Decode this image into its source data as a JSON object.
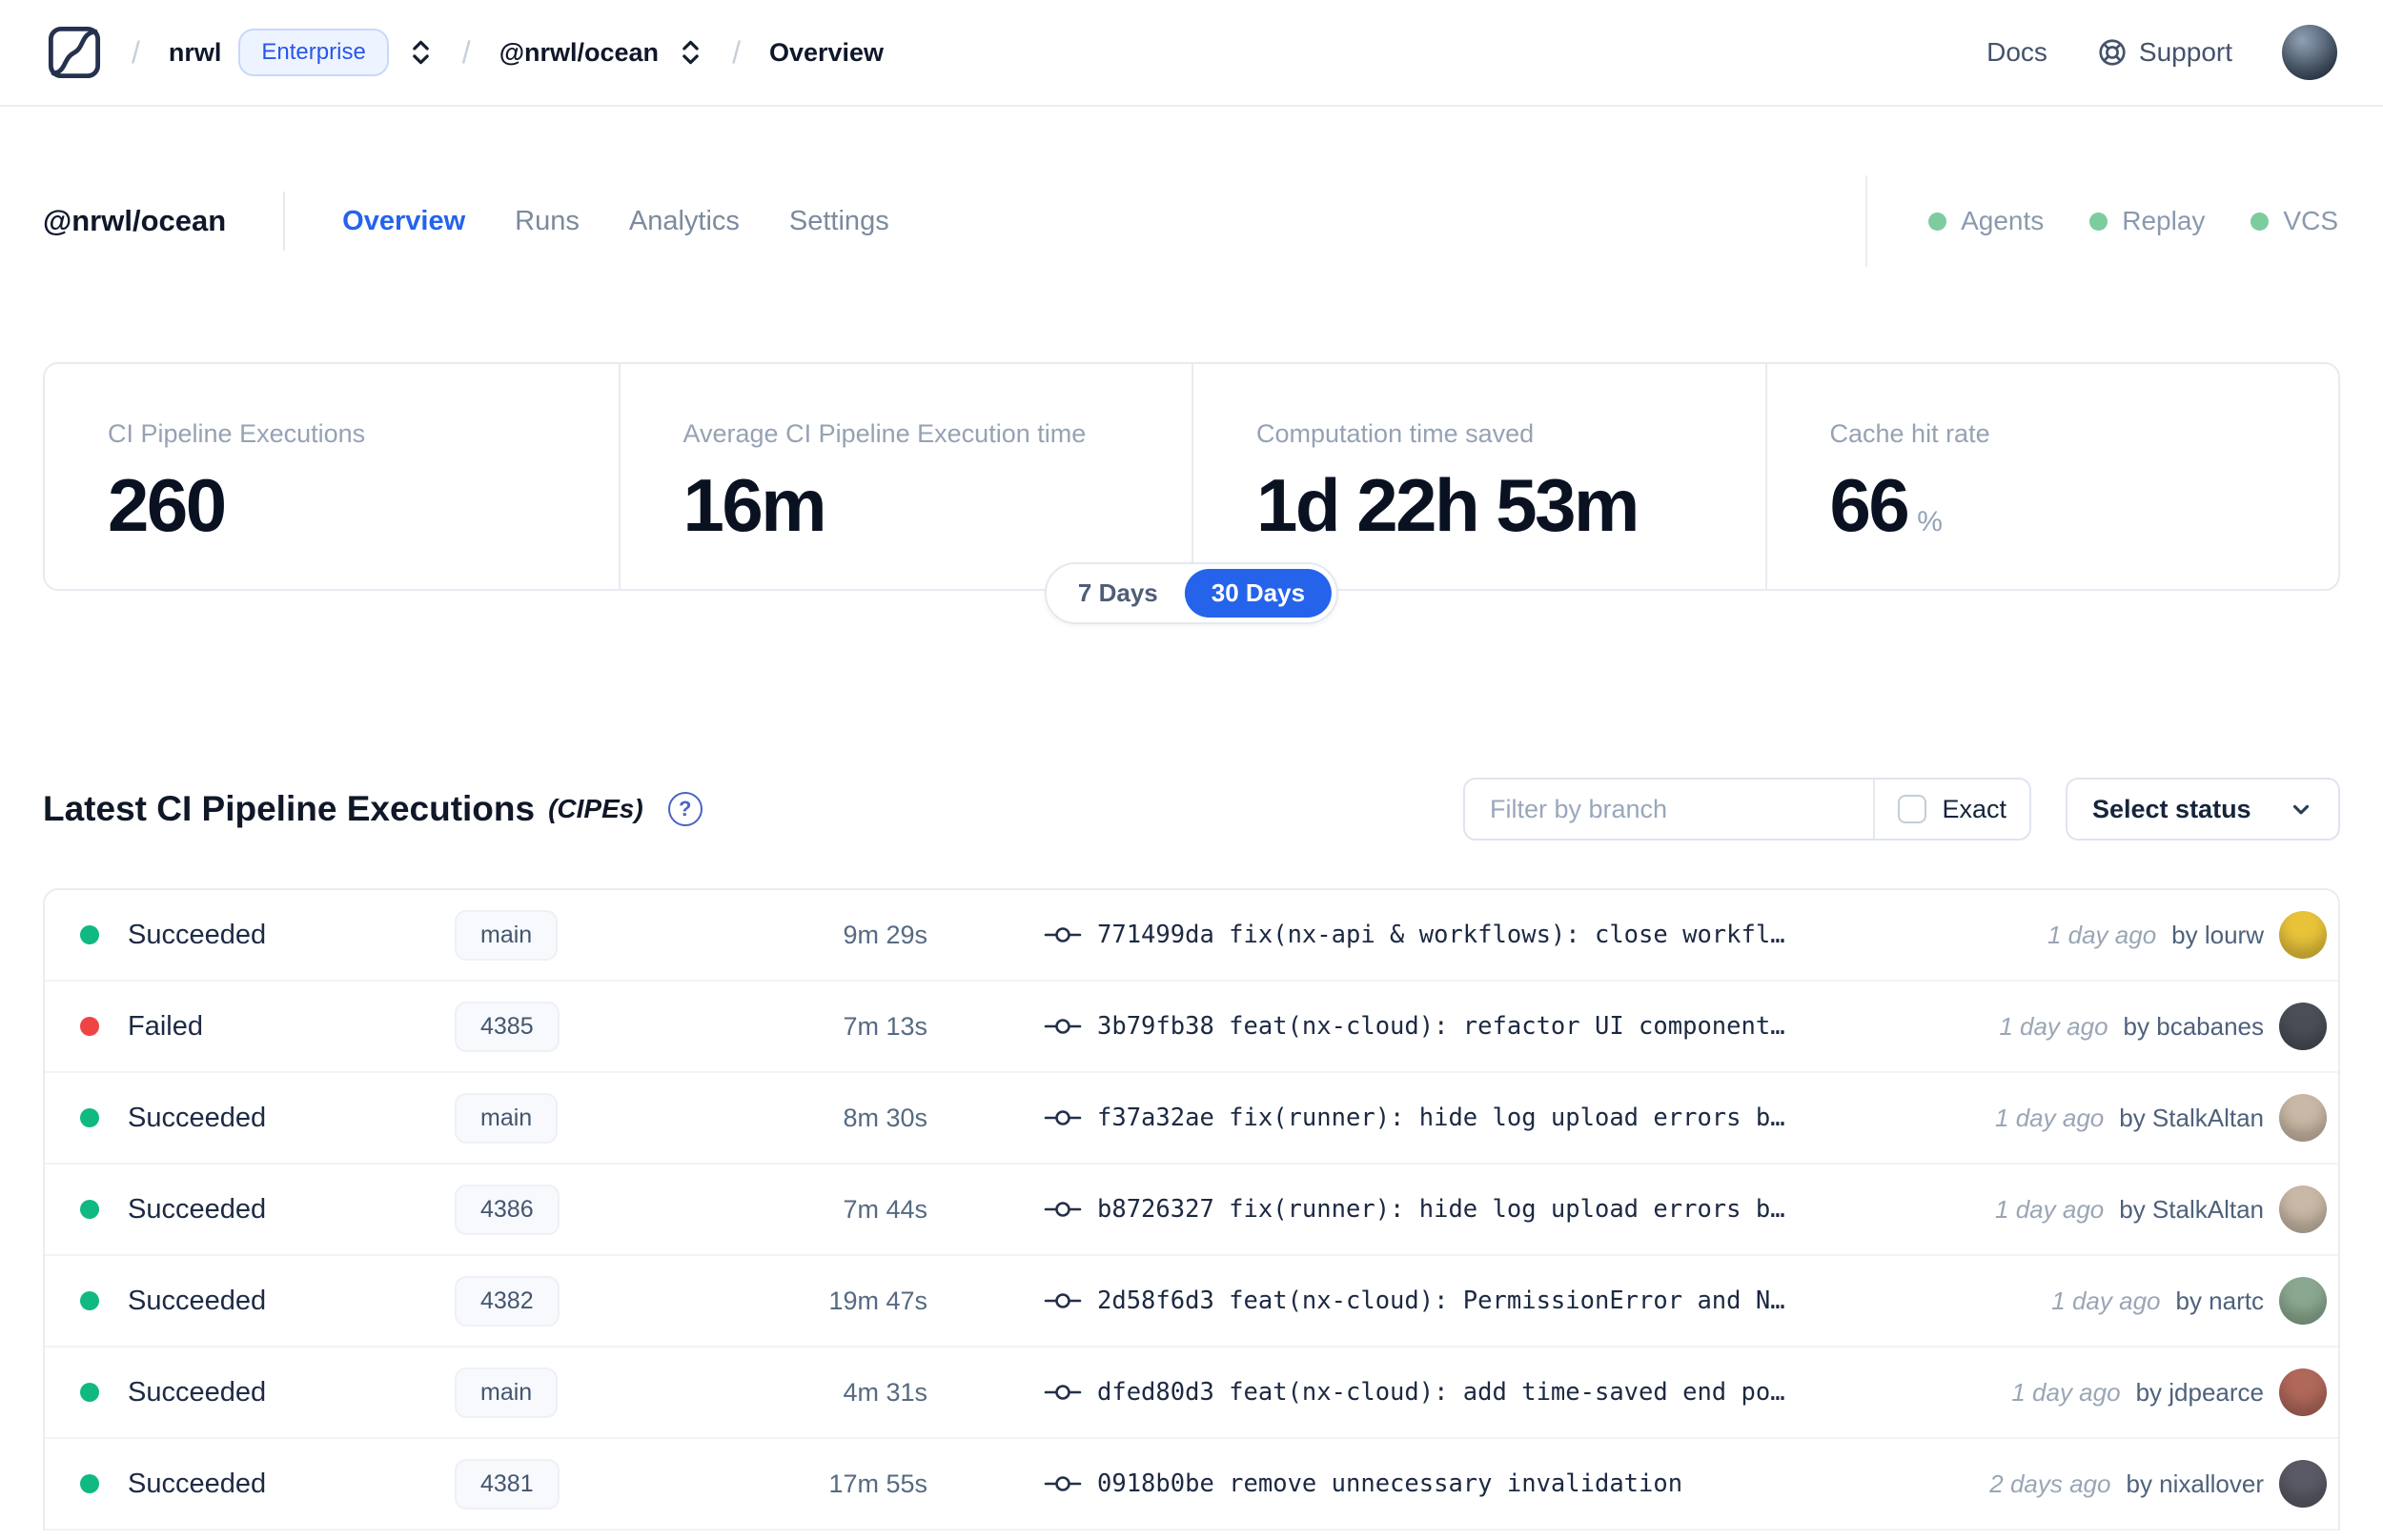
{
  "header": {
    "breadcrumb": {
      "org": "nrwl",
      "org_badge": "Enterprise",
      "workspace": "@nrwl/ocean",
      "page": "Overview"
    },
    "docs_label": "Docs",
    "support_label": "Support"
  },
  "workspace_nav": {
    "title": "@nrwl/ocean",
    "tabs": [
      {
        "label": "Overview",
        "active": true
      },
      {
        "label": "Runs",
        "active": false
      },
      {
        "label": "Analytics",
        "active": false
      },
      {
        "label": "Settings",
        "active": false
      }
    ],
    "indicators": [
      {
        "label": "Agents",
        "status_color": "#7ccc9e"
      },
      {
        "label": "Replay",
        "status_color": "#7ccc9e"
      },
      {
        "label": "VCS",
        "status_color": "#7ccc9e"
      }
    ]
  },
  "stats": {
    "cards": [
      {
        "label": "CI Pipeline Executions",
        "value": "260"
      },
      {
        "label": "Average CI Pipeline Execution time",
        "value": "16m"
      },
      {
        "label": "Computation time saved",
        "value": "1d 22h 53m"
      },
      {
        "label": "Cache hit rate",
        "value": "66",
        "unit": "%"
      }
    ],
    "period_toggle": {
      "options": [
        "7 Days",
        "30 Days"
      ],
      "selected": "30 Days"
    }
  },
  "cipe_section": {
    "title": "Latest CI Pipeline Executions",
    "title_suffix": "(CIPEs)",
    "filter": {
      "placeholder": "Filter by branch",
      "exact_label": "Exact"
    },
    "status_select_label": "Select status",
    "rows": [
      {
        "status": "Succeeded",
        "branch": "main",
        "duration": "9m 29s",
        "commit": "771499da fix(nx-api & workflows): close workfl…",
        "time": "1 day ago",
        "author": "by lourw",
        "avatar_color": "#e8c33a"
      },
      {
        "status": "Failed",
        "branch": "4385",
        "duration": "7m 13s",
        "commit": "3b79fb38 feat(nx-cloud): refactor UI component…",
        "time": "1 day ago",
        "author": "by bcabanes",
        "avatar_color": "#4a4e57"
      },
      {
        "status": "Succeeded",
        "branch": "main",
        "duration": "8m 30s",
        "commit": "f37a32ae fix(runner): hide log upload errors b…",
        "time": "1 day ago",
        "author": "by StalkAltan",
        "avatar_color": "#c9b8a6"
      },
      {
        "status": "Succeeded",
        "branch": "4386",
        "duration": "7m 44s",
        "commit": "b8726327 fix(runner): hide log upload errors b…",
        "time": "1 day ago",
        "author": "by StalkAltan",
        "avatar_color": "#c9b8a6"
      },
      {
        "status": "Succeeded",
        "branch": "4382",
        "duration": "19m 47s",
        "commit": "2d58f6d3 feat(nx-cloud): PermissionError and N…",
        "time": "1 day ago",
        "author": "by nartc",
        "avatar_color": "#8aa88f"
      },
      {
        "status": "Succeeded",
        "branch": "main",
        "duration": "4m 31s",
        "commit": "dfed80d3 feat(nx-cloud): add time-saved end po…",
        "time": "1 day ago",
        "author": "by jdpearce",
        "avatar_color": "#b0685a"
      },
      {
        "status": "Succeeded",
        "branch": "4381",
        "duration": "17m 55s",
        "commit": "0918b0be remove unnecessary invalidation",
        "time": "2 days ago",
        "author": "by nixallover",
        "avatar_color": "#5a5a66"
      }
    ]
  },
  "colors": {
    "accent": "#2563eb",
    "succeeded": "#10b981",
    "failed": "#ef4444",
    "indicator_green": "#7ccc9e"
  }
}
